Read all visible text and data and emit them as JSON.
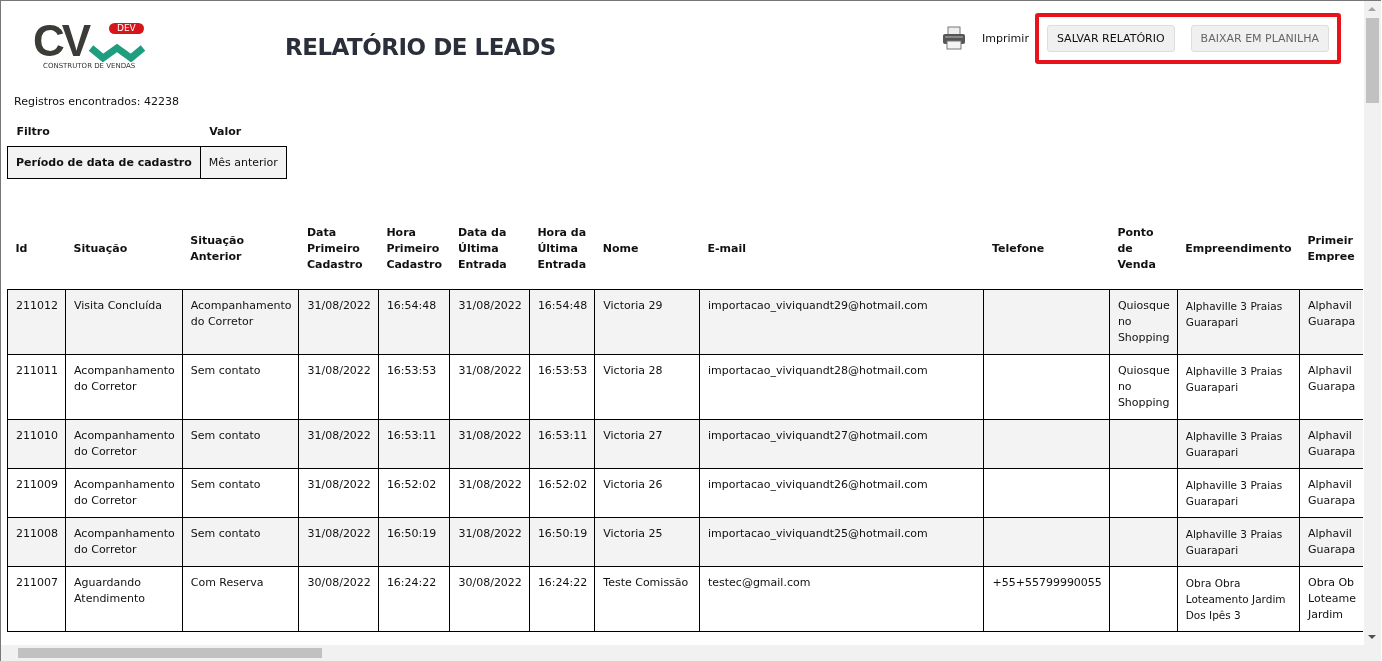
{
  "logo": {
    "mark": "CV",
    "badge": "DEV",
    "tagline": "CONSTRUTOR DE VENDAS"
  },
  "title": "RELATÓRIO DE LEADS",
  "print_link": "Imprimir",
  "buttons": [
    {
      "label": "SALVAR RELATÓRIO",
      "disabled": false
    },
    {
      "label": "BAIXAR EM PLANILHA",
      "disabled": true
    }
  ],
  "records_found": "Registros encontrados: 42238",
  "filter_table": {
    "columns": [
      "Filtro",
      "Valor"
    ],
    "rows": [
      [
        "Período de data de cadastro",
        "Mês anterior"
      ]
    ]
  },
  "table": {
    "columns": [
      "Id",
      "Situação",
      "Situação Anterior",
      "Data Primeiro Cadastro",
      "Hora Primeiro Cadastro",
      "Data da Última Entrada",
      "Hora da Última Entrada",
      "Nome",
      "E-mail",
      "Telefone",
      "Ponto de Venda",
      "Empreendimento",
      "Primeir\nEmpree"
    ],
    "rows": [
      [
        "211012",
        "Visita Concluída",
        "Acompanhamento do Corretor",
        "31/08/2022",
        "16:54:48",
        "31/08/2022",
        "16:54:48",
        "Victoria 29",
        "importacao_viviquandt29@hotmail.com",
        null,
        "Quiosque no Shopping",
        "Alphaville 3 Praias Guarapari",
        "Alphavil\nGuarapa"
      ],
      [
        "211011",
        "Acompanhamento do Corretor",
        "Sem contato",
        "31/08/2022",
        "16:53:53",
        "31/08/2022",
        "16:53:53",
        "Victoria 28",
        "importacao_viviquandt28@hotmail.com",
        null,
        "Quiosque no Shopping",
        "Alphaville 3 Praias Guarapari",
        "Alphavil\nGuarapa"
      ],
      [
        "211010",
        "Acompanhamento do Corretor",
        "Sem contato",
        "31/08/2022",
        "16:53:11",
        "31/08/2022",
        "16:53:11",
        "Victoria 27",
        "importacao_viviquandt27@hotmail.com",
        null,
        null,
        "Alphaville 3 Praias Guarapari",
        "Alphavil\nGuarapa"
      ],
      [
        "211009",
        "Acompanhamento do Corretor",
        "Sem contato",
        "31/08/2022",
        "16:52:02",
        "31/08/2022",
        "16:52:02",
        "Victoria 26",
        "importacao_viviquandt26@hotmail.com",
        null,
        null,
        "Alphaville 3 Praias Guarapari",
        "Alphavil\nGuarapa"
      ],
      [
        "211008",
        "Acompanhamento do Corretor",
        "Sem contato",
        "31/08/2022",
        "16:50:19",
        "31/08/2022",
        "16:50:19",
        "Victoria 25",
        "importacao_viviquandt25@hotmail.com",
        null,
        null,
        "Alphaville 3 Praias Guarapari",
        "Alphavil\nGuarapa"
      ],
      [
        "211007",
        "Aguardando Atendimento",
        "Com Reserva",
        "30/08/2022",
        "16:24:22",
        "30/08/2022",
        "16:24:22",
        "Teste Comissão",
        "testec@gmail.com",
        "+55+55799990055",
        null,
        "Obra Obra Loteamento Jardim Dos Ipês 3",
        "Obra Ob\nLoteame\nJardim"
      ]
    ]
  }
}
